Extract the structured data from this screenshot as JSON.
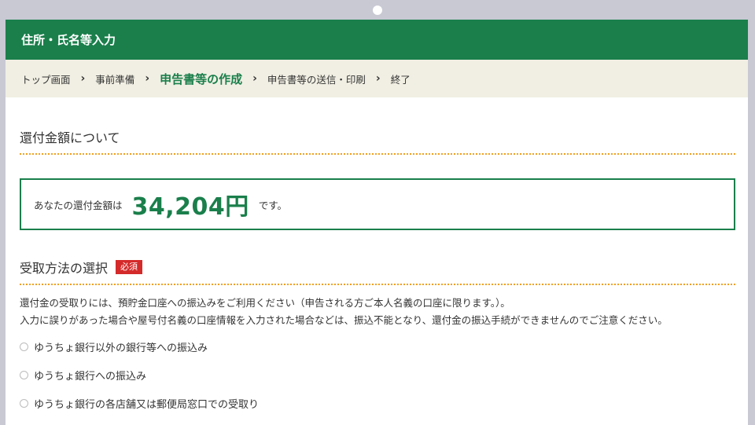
{
  "window": {
    "title": "住所・氏名等入力"
  },
  "breadcrumb": {
    "items": [
      {
        "label": "トップ画面",
        "active": false
      },
      {
        "label": "事前準備",
        "active": false
      },
      {
        "label": "申告書等の作成",
        "active": true
      },
      {
        "label": "申告書等の送信・印刷",
        "active": false
      },
      {
        "label": "終了",
        "active": false
      }
    ],
    "separator": "›"
  },
  "refund_section": {
    "title": "還付金額について",
    "prefix": "あなたの還付金額は",
    "amount": "34,204円",
    "suffix": "です。"
  },
  "receipt_section": {
    "title": "受取方法の選択",
    "required_badge": "必須",
    "note_line1": "還付金の受取りには、預貯金口座への振込みをご利用ください（申告される方ご本人名義の口座に限ります。）。",
    "note_line2": "入力に誤りがあった場合や屋号付名義の口座情報を入力された場合などは、振込不能となり、還付金の振込手続ができませんのでご注意ください。",
    "options": [
      {
        "label": "ゆうちょ銀行以外の銀行等への振込み",
        "selected": false
      },
      {
        "label": "ゆうちょ銀行への振込み",
        "selected": false
      },
      {
        "label": "ゆうちょ銀行の各店舗又は郵便局窓口での受取り",
        "selected": false
      }
    ]
  },
  "colors": {
    "brand_green": "#1a7f4b",
    "breadcrumb_bg": "#f1efe3",
    "required_red": "#d42a2a",
    "divider_orange": "#f0a020"
  }
}
